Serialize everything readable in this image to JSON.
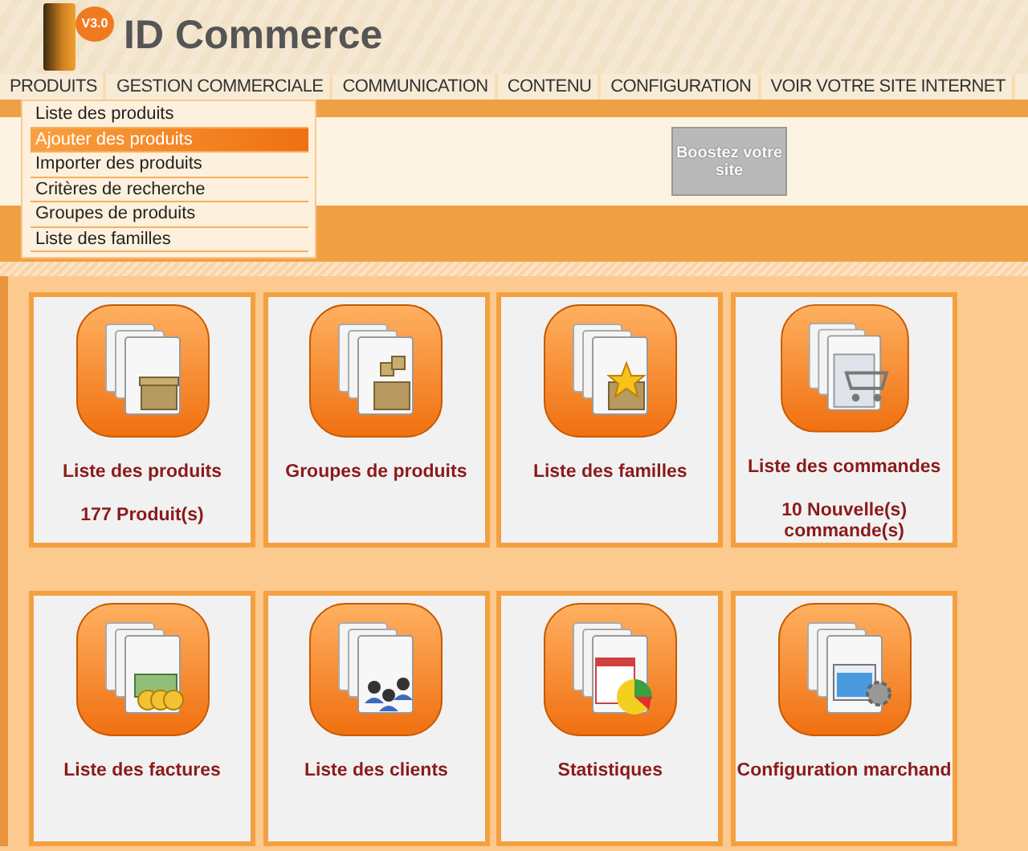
{
  "logo": {
    "version": "V3.0",
    "title": "ID Commerce"
  },
  "menu": [
    {
      "label": "PRODUITS",
      "submenu": [
        {
          "label": "Liste des produits",
          "selected": false
        },
        {
          "label": "Ajouter des produits",
          "selected": true
        },
        {
          "label": "Importer des produits",
          "selected": false
        },
        {
          "label": "Critères de recherche",
          "selected": false
        },
        {
          "label": "Groupes de produits",
          "selected": false
        },
        {
          "label": "Liste des familles",
          "selected": false
        }
      ]
    },
    {
      "label": "GESTION COMMERCIALE"
    },
    {
      "label": "COMMUNICATION"
    },
    {
      "label": "CONTENU"
    },
    {
      "label": "CONFIGURATION"
    },
    {
      "label": "VOIR VOTRE SITE INTERNET"
    }
  ],
  "banner": {
    "text": "Boostez votre site"
  },
  "tiles": [
    {
      "kind": "box",
      "title": "Liste des produits",
      "subtitle": "177 Produit(s)"
    },
    {
      "kind": "parcel",
      "title": "Groupes de produits"
    },
    {
      "kind": "star",
      "title": "Liste des familles"
    },
    {
      "kind": "cart",
      "title": "Liste des commandes",
      "subtitle": "10 Nouvelle(s) commande(s)"
    },
    {
      "kind": "money",
      "title": "Liste des factures"
    },
    {
      "kind": "users",
      "title": "Liste des clients"
    },
    {
      "kind": "chart",
      "title": "Statistiques"
    },
    {
      "kind": "config",
      "title": "Configuration marchand"
    }
  ]
}
